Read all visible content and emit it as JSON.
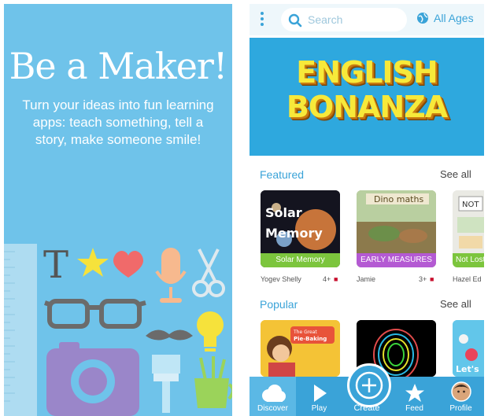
{
  "left_panel": {
    "title": "Be a Maker!",
    "subtitle": "Turn your ideas into fun learning apps: teach something, tell a story, make someone smile!",
    "background_color": "#6fc3ea",
    "icons": [
      "text-icon",
      "star-icon",
      "heart-icon",
      "microphone-icon",
      "scissors-icon",
      "glasses-icon",
      "mustache-icon",
      "lightbulb-icon",
      "camera-icon",
      "paintbrush-icon",
      "pencil-cup-icon",
      "ruler-icon"
    ]
  },
  "app": {
    "search": {
      "placeholder": "Search"
    },
    "age_filter": "All Ages",
    "banner": {
      "line1": "ENGLISH",
      "line2": "BONANZA"
    },
    "featured": {
      "title": "Featured",
      "see_all": "See all",
      "cards": [
        {
          "image_text": "Solar Memory",
          "label": "Solar Memory",
          "label_color": "#7cc53d",
          "author": "Yogev Shelly",
          "age": "4+"
        },
        {
          "image_text": "Dino maths",
          "label": "EARLY MEASURES",
          "label_color": "#b45ad3",
          "author": "Jamie",
          "age": "3+"
        },
        {
          "image_text": "NOT",
          "label": "Not Lost a",
          "label_color": "#7cc53d",
          "author": "Hazel Ed",
          "age": ""
        }
      ]
    },
    "popular": {
      "title": "Popular",
      "see_all": "See all",
      "cards": [
        {
          "image_text": "The Great Pie-Baking Adventure"
        },
        {
          "image_text": ""
        },
        {
          "image_text": "Let's"
        }
      ]
    },
    "tabs": [
      {
        "label": "Discover",
        "icon": "cloud-icon",
        "active": true
      },
      {
        "label": "Play",
        "icon": "play-icon",
        "active": false
      },
      {
        "label": "Create",
        "icon": "plus-icon",
        "active": false
      },
      {
        "label": "Feed",
        "icon": "star-icon",
        "active": false
      },
      {
        "label": "Profile",
        "icon": "avatar",
        "active": false
      }
    ],
    "colors": {
      "accent": "#3aa3d8",
      "banner_bg": "#2ea8de",
      "banner_text": "#f7e93a"
    }
  }
}
